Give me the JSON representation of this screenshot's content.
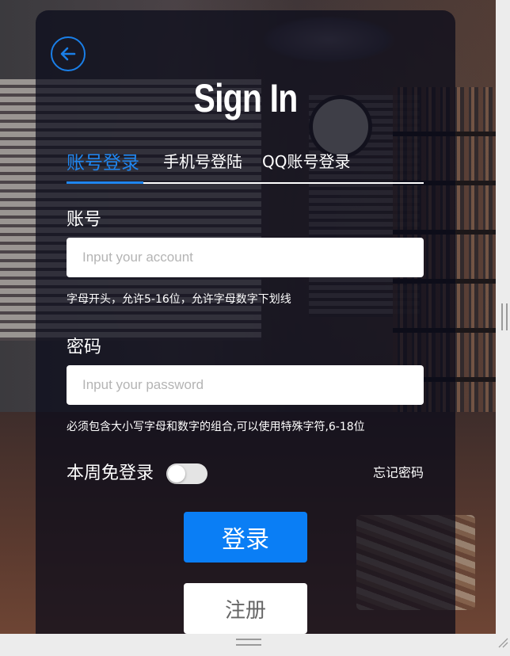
{
  "page": {
    "title": "Sign In"
  },
  "tabs": [
    {
      "label": "账号登录",
      "active": true
    },
    {
      "label": "手机号登陆",
      "active": false
    },
    {
      "label": "QQ账号登录",
      "active": false
    }
  ],
  "account": {
    "label": "账号",
    "placeholder": "Input your account",
    "value": "",
    "hint": "字母开头，允许5-16位，允许字母数字下划线"
  },
  "password": {
    "label": "密码",
    "placeholder": "Input your password",
    "value": "",
    "hint": "必须包含大小写字母和数字的组合,可以使用特殊字符,6-18位"
  },
  "remember": {
    "label": "本周免登录",
    "enabled": false
  },
  "forgot_label": "忘记密码",
  "buttons": {
    "login": "登录",
    "register": "注册"
  },
  "icons": {
    "back": "arrow-left-circle-icon"
  },
  "colors": {
    "accent": "#1f86f0",
    "button_primary": "#0a7ef5",
    "panel": "rgba(8,10,25,0.72)"
  }
}
